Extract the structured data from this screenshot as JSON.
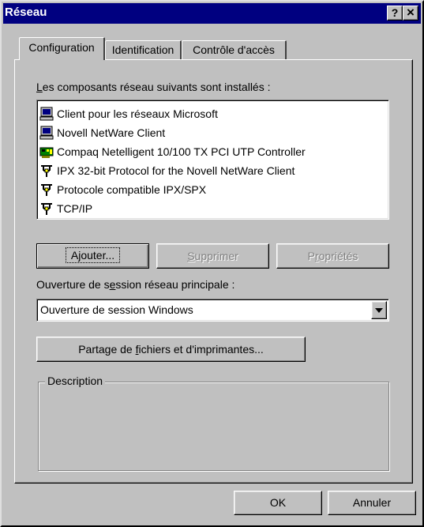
{
  "window": {
    "title": "Réseau",
    "help_button": "?",
    "close_button": "×"
  },
  "tabs": [
    {
      "label": "Configuration"
    },
    {
      "label": "Identification"
    },
    {
      "label": "Contrôle d'accès"
    }
  ],
  "components": {
    "label_prefix": "",
    "label_underline": "L",
    "label_rest": "es composants réseau suivants sont installés :",
    "items": [
      {
        "label": "Client pour les réseaux Microsoft",
        "icon": "network-client-icon"
      },
      {
        "label": "Novell NetWare Client",
        "icon": "network-client-icon"
      },
      {
        "label": "Compaq Netelligent 10/100 TX PCI UTP Controller",
        "icon": "network-adapter-icon"
      },
      {
        "label": "IPX 32-bit Protocol for the Novell NetWare Client",
        "icon": "protocol-icon"
      },
      {
        "label": "Protocole compatible IPX/SPX",
        "icon": "protocol-icon"
      },
      {
        "label": "TCP/IP",
        "icon": "protocol-icon"
      }
    ]
  },
  "buttons": {
    "add_pre": "A",
    "add_ul": "j",
    "add_post": "outer...",
    "remove_ul": "S",
    "remove_post": "upprimer",
    "props_pre": "P",
    "props_ul": "r",
    "props_post": "opriétés"
  },
  "logon": {
    "label_pre": "Ouverture de s",
    "label_ul": "e",
    "label_post": "ssion réseau principale :",
    "selected": "Ouverture de session Windows"
  },
  "sharing": {
    "pre": "Partage de ",
    "ul": "f",
    "post": "ichiers et d'imprimantes..."
  },
  "description": {
    "legend": "Description"
  },
  "footer": {
    "ok_label": "OK",
    "cancel_label": "Annuler"
  }
}
